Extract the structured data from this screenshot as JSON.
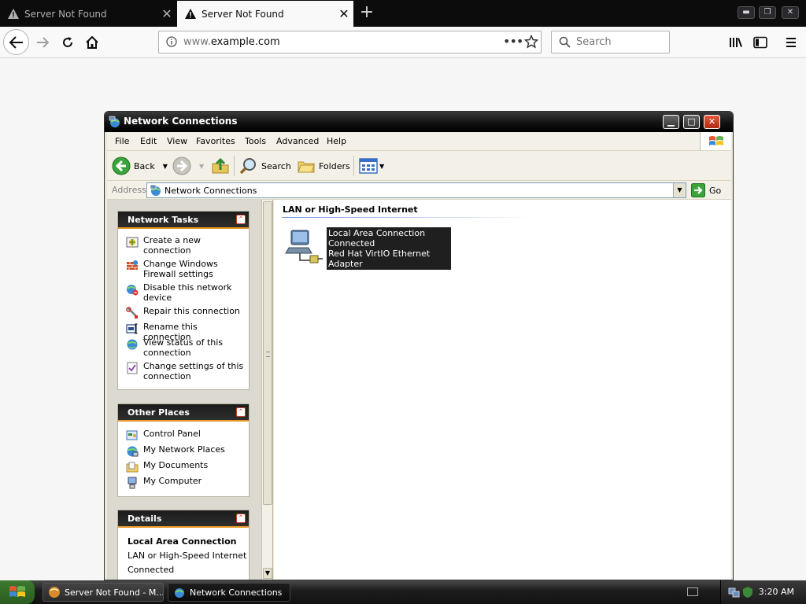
{
  "browser": {
    "tabs": [
      {
        "title": "Server Not Found",
        "active": false
      },
      {
        "title": "Server Not Found",
        "active": true
      }
    ],
    "url_prefix": "www.",
    "url_host": "example.com",
    "search_placeholder": "Search"
  },
  "window": {
    "title": "Network Connections",
    "menu": [
      "File",
      "Edit",
      "View",
      "Favorites",
      "Tools",
      "Advanced",
      "Help"
    ],
    "toolbar": {
      "back": "Back",
      "search": "Search",
      "folders": "Folders"
    },
    "address": {
      "label": "Address",
      "value": "Network Connections",
      "go": "Go"
    }
  },
  "taskpane": {
    "network_tasks": {
      "title": "Network Tasks",
      "items": [
        {
          "label": "Create a new connection",
          "icon": "new-connection-icon"
        },
        {
          "label": "Change Windows Firewall settings",
          "icon": "firewall-icon"
        },
        {
          "label": "Disable this network device",
          "icon": "disable-network-icon"
        },
        {
          "label": "Repair this connection",
          "icon": "repair-icon"
        },
        {
          "label": "Rename this connection",
          "icon": "rename-icon"
        },
        {
          "label": "View status of this connection",
          "icon": "status-icon"
        },
        {
          "label": "Change settings of this connection",
          "icon": "settings-icon"
        }
      ]
    },
    "other_places": {
      "title": "Other Places",
      "items": [
        {
          "label": "Control Panel",
          "icon": "control-panel-icon"
        },
        {
          "label": "My Network Places",
          "icon": "network-places-icon"
        },
        {
          "label": "My Documents",
          "icon": "documents-icon"
        },
        {
          "label": "My Computer",
          "icon": "computer-icon"
        }
      ]
    },
    "details": {
      "title": "Details",
      "name": "Local Area Connection",
      "type": "LAN or High-Speed Internet",
      "status": "Connected"
    }
  },
  "content": {
    "group": "LAN or High-Speed Internet",
    "connection": {
      "name": "Local Area Connection",
      "status": "Connected",
      "device": "Red Hat VirtIO Ethernet Adapter"
    }
  },
  "taskbar": {
    "tasks": [
      "Server Not Found - M...",
      "Network Connections"
    ],
    "clock": "3:20 AM"
  }
}
